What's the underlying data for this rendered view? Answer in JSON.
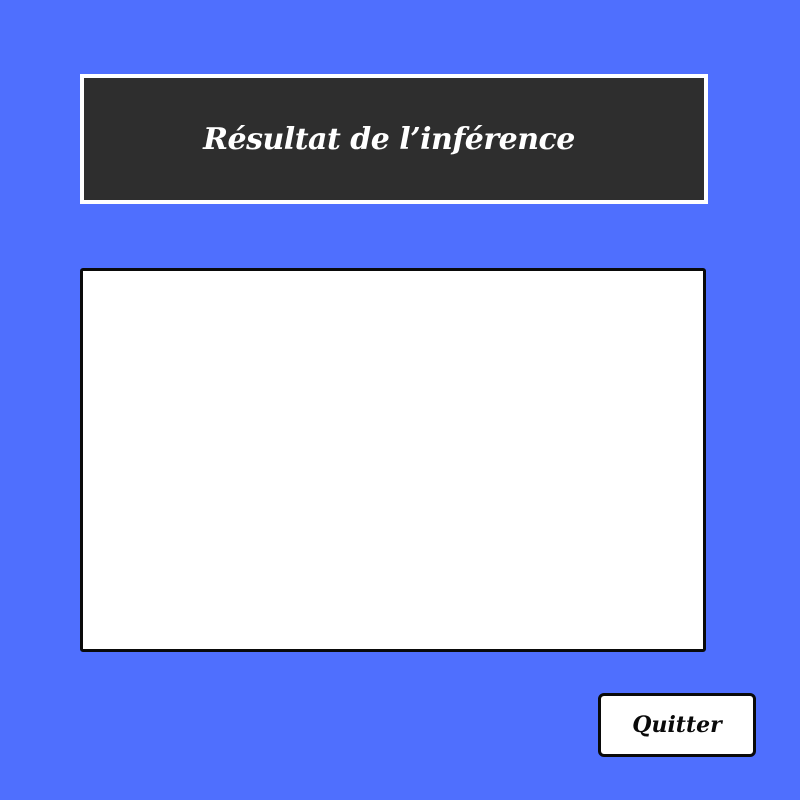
{
  "window": {
    "background_color": "#4f6ffe"
  },
  "header": {
    "title": "Résultat de l’inférence",
    "background_color": "#2e2e2e",
    "text_color": "#ffffff"
  },
  "result_panel": {
    "content": ""
  },
  "actions": {
    "quit_label": "Quitter"
  }
}
